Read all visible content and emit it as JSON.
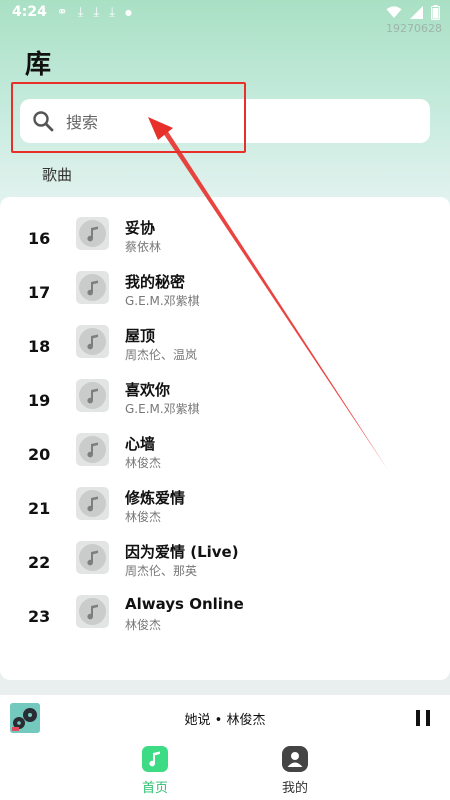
{
  "status_bar": {
    "time": "4:24",
    "build_id": "19270628"
  },
  "page": {
    "title": "库",
    "section_label": "歌曲"
  },
  "search": {
    "placeholder": "搜索"
  },
  "songs": [
    {
      "index": "16",
      "title": "妥协",
      "artist": "蔡依林"
    },
    {
      "index": "17",
      "title": "我的秘密",
      "artist": "G.E.M.邓紫棋"
    },
    {
      "index": "18",
      "title": "屋顶",
      "artist": "周杰伦、温岚"
    },
    {
      "index": "19",
      "title": "喜欢你",
      "artist": "G.E.M.邓紫棋"
    },
    {
      "index": "20",
      "title": "心墙",
      "artist": "林俊杰"
    },
    {
      "index": "21",
      "title": "修炼爱情",
      "artist": "林俊杰"
    },
    {
      "index": "22",
      "title": "因为爱情 (Live)",
      "artist": "周杰伦、那英"
    },
    {
      "index": "23",
      "title": "Always Online",
      "artist": "林俊杰"
    }
  ],
  "player": {
    "now_playing": "她说 • 林俊杰"
  },
  "tabs": [
    {
      "label": "首页",
      "icon": "music-note-icon",
      "active": true
    },
    {
      "label": "我的",
      "icon": "user-icon",
      "active": false
    }
  ],
  "colors": {
    "accent": "#3ddc84",
    "annotation": "#e8302b"
  }
}
